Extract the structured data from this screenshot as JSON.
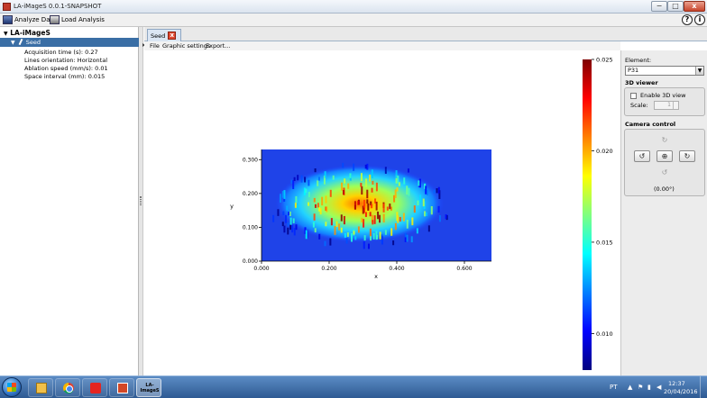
{
  "window": {
    "title": "LA-iMageS 0.0.1-SNAPSHOT",
    "minimize": "−",
    "maximize": "□",
    "close": "x"
  },
  "toolbar": {
    "analyze_label": "Analyze Data",
    "load_label": "Load Analysis",
    "help": "?",
    "info": "i"
  },
  "tree": {
    "root": "LA-iMageS",
    "root_toggle": "▼",
    "seed_toggle": "▼",
    "seed": "Seed",
    "properties": [
      "Acquisition time (s): 0.27",
      "Lines orientation: Horizontal",
      "Ablation speed (mm/s): 0.01",
      "Space interval (mm): 0.015"
    ]
  },
  "tabs": [
    {
      "label": "Seed",
      "close": "x"
    }
  ],
  "menu": {
    "file": "File",
    "graphic_settings": "Graphic settings",
    "export": "Export..."
  },
  "panel": {
    "element_label": "Element:",
    "element_value": "P31",
    "viewer_title": "3D viewer",
    "enable_3d_label": "Enable 3D view",
    "scale_label": "Scale:",
    "scale_value": "1",
    "camera_title": "Camera control",
    "camera_angle": "(0.00°)"
  },
  "chart_data": {
    "type": "heatmap",
    "xlabel": "x",
    "ylabel": "y",
    "xlim": [
      0.0,
      0.68
    ],
    "ylim": [
      0.0,
      0.33
    ],
    "x_ticks": [
      "0.000",
      "0.200",
      "0.400",
      "0.600"
    ],
    "x_tick_values": [
      0.0,
      0.2,
      0.4,
      0.6
    ],
    "y_ticks": [
      "0.000",
      "0.100",
      "0.200",
      "0.300"
    ],
    "y_tick_values": [
      0.0,
      0.1,
      0.2,
      0.3
    ],
    "colorbar": {
      "min": 0.008,
      "max": 0.025,
      "ticks": [
        "0.010",
        "0.015",
        "0.020",
        "0.025"
      ],
      "tick_values": [
        0.01,
        0.015,
        0.02,
        0.025
      ]
    },
    "blob": {
      "center_x": 0.29,
      "center_y": 0.17,
      "radius_x": 0.25,
      "radius_y": 0.115,
      "peak_value": 0.024,
      "background_value": 0.009
    },
    "colormap": "jet",
    "grid": false
  },
  "taskbar": {
    "app_label": "LA-\nImageS",
    "lang": "PT",
    "time": "12:37",
    "date": "20/04/2016"
  }
}
